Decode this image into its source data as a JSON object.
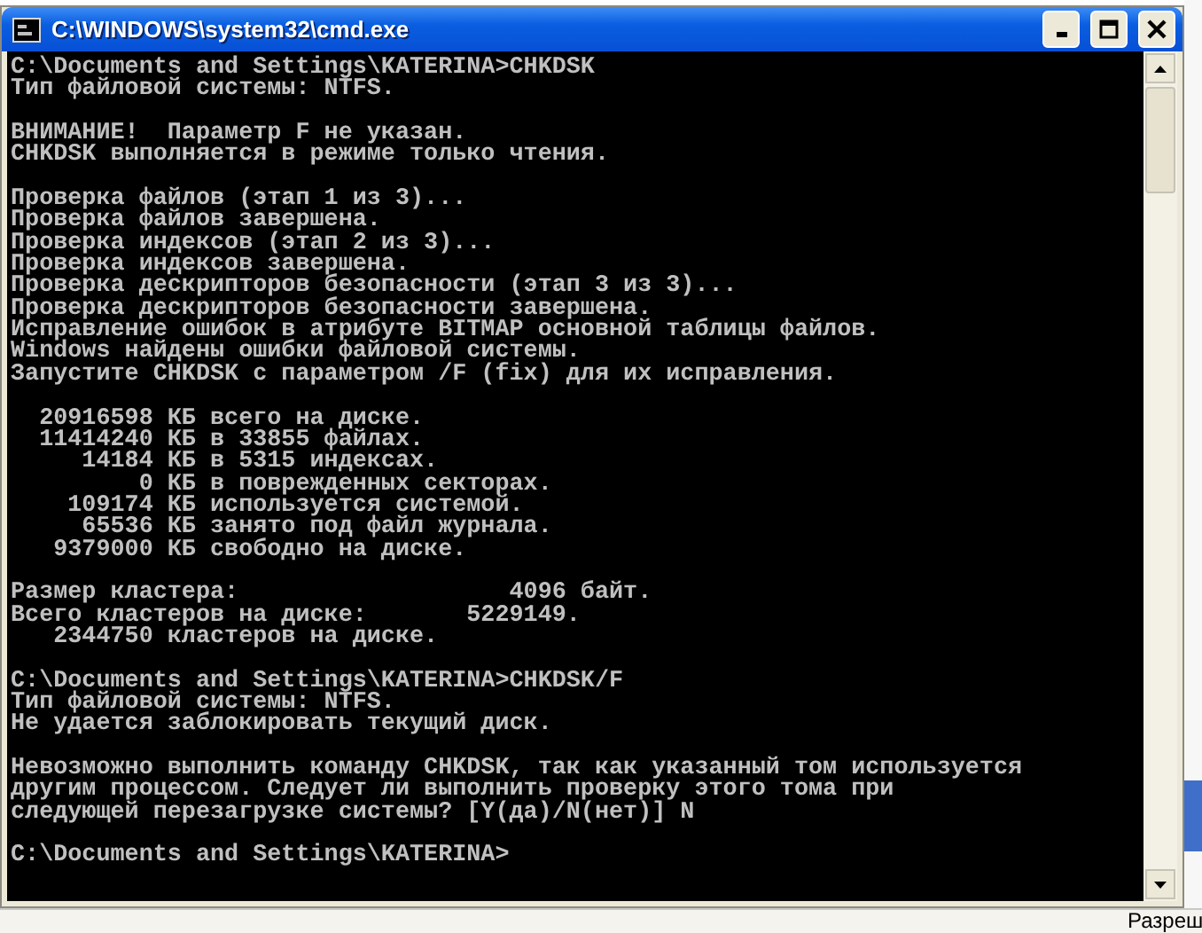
{
  "window": {
    "title": "C:\\WINDOWS\\system32\\cmd.exe"
  },
  "console": {
    "blocks": [
      {
        "lines": [
          "C:\\Documents and Settings\\KATERINA>CHKDSK",
          "Тип файловой системы: NTFS."
        ]
      },
      {
        "lines": [
          "ВНИМАНИЕ!  Параметр F не указан.",
          "CHKDSK выполняется в режиме только чтения."
        ]
      },
      {
        "lines": [
          "Проверка файлов (этап 1 из 3)...",
          "Проверка файлов завершена.",
          "Проверка индексов (этап 2 из 3)...",
          "Проверка индексов завершена.",
          "Проверка дескрипторов безопасности (этап 3 из 3)...",
          "Проверка дескрипторов безопасности завершена.",
          "Исправление ошибок в атрибуте BITMAP основной таблицы файлов.",
          "Windows найдены ошибки файловой системы.",
          "Запустите CHKDSK с параметром /F (fix) для их исправления."
        ]
      },
      {
        "lines": [
          "  20916598 КБ всего на диске.",
          "  11414240 КБ в 33855 файлах.",
          "     14184 КБ в 5315 индексах.",
          "         0 КБ в поврежденных секторах.",
          "    109174 КБ используется системой.",
          "     65536 КБ занято под файл журнала.",
          "   9379000 КБ свободно на диске."
        ]
      },
      {
        "lines": [
          "Размер кластера:                   4096 байт.",
          "Всего кластеров на диске:       5229149.",
          "   2344750 кластеров на диске."
        ]
      },
      {
        "lines": [
          "C:\\Documents and Settings\\KATERINA>CHKDSK/F",
          "Тип файловой системы: NTFS.",
          "Не удается заблокировать текущий диск."
        ]
      },
      {
        "lines": [
          "Невозможно выполнить команду CHKDSK, так как указанный том используется",
          "другим процессом. Следует ли выполнить проверку этого тома при",
          "следующей перезагрузке системы? [Y(да)/N(нет)] N"
        ]
      },
      {
        "lines": [
          "C:\\Documents and Settings\\KATERINA>"
        ]
      }
    ]
  },
  "background_window": {
    "text": "Разреш"
  }
}
